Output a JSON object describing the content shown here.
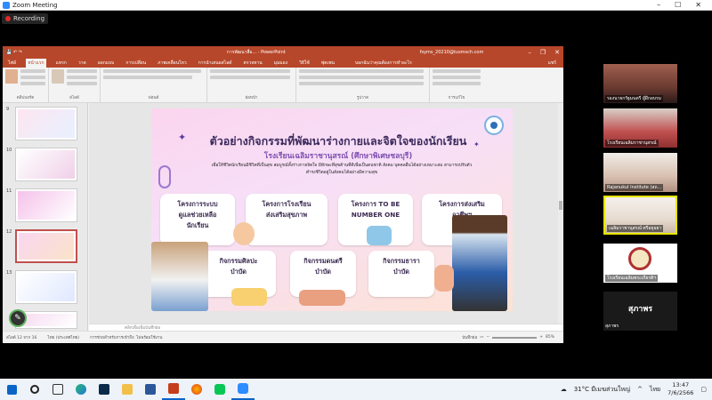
{
  "zoom": {
    "title": "Zoom Meeting",
    "recording": "Recording",
    "window_controls": [
      "–",
      "☐",
      "✕"
    ]
  },
  "ppt": {
    "doc_title": "การพัฒนาสื่อ... - PowerPoint",
    "user": "fsyms_20210@tusmsch.com",
    "tabs": [
      "ไฟล์",
      "หน้าแรก",
      "แทรก",
      "วาด",
      "ออกแบบ",
      "การเปลี่ยน",
      "ภาพเคลื่อนไหว",
      "การนำเสนอสไลด์",
      "ตรวจทาน",
      "มุมมอง",
      "วิธีใช้",
      "ฟุตเพน",
      "Tell me",
      "บอกฉันว่าคุณต้องการทำอะไร"
    ],
    "active_tab_index": 1,
    "share": "แชร์",
    "ribbon_groups": [
      "คลิปบอร์ด",
      "สไลด์",
      "ฟอนต์",
      "ย่อหน้า",
      "รูปวาด",
      "การแก้ไข"
    ],
    "thumb_numbers": [
      "9",
      "10",
      "11",
      "12",
      "13"
    ],
    "selected_slide": "12",
    "notes_placeholder": "คลิกเพื่อเพิ่มบันทึกย่อ",
    "status_left": "สไลด์ 12 จาก 16",
    "status_lang": "ไทย (ประเทศไทย)",
    "status_access": "การช่วยสำหรับการเข้าถึง: ไม่พร้อมใช้งาน",
    "status_notes": "บันทึกย่อ",
    "zoom_level": "85%"
  },
  "slide": {
    "title": "ตัวอย่างกิจกรรมที่พัฒนาร่างกายและจิตใจของนักเรียน",
    "subtitle": "โรงเรียนเฉลิมราชานุสรณ์ (ศึกษาพิเศษชลบุรี)",
    "description": "เพื่อให้ชีวิตนักเรียนมีชีวิตที่เป็นสุข สมบูรณ์ทั้งร่างกายจิตใจ มีทักษะที่สุขด้านที่ดีเพื่อเป็นตนชาติ สังคม บุคคลอื่นได้อย่างเหมาะสม สามารถปรับตัวดำรงชีวิตอยู่ในสังคมได้อย่างมีความสุข",
    "cards": [
      "โครงการระบบ\nดูแลช่วยเหลือ\nนักเรียน",
      "โครงการโรงเรียน\nส่งเสริมสุขภาพ",
      "โครงการ TO BE\nNUMBER ONE",
      "โครงการส่งเสริม\nอาชีพฯ",
      "กิจกรรมศิลปะ\nบำบัด",
      "กิจกรรมดนตรี\nบำบัด",
      "กิจกรรมธารา\nบำบัด"
    ]
  },
  "participants": [
    {
      "name": "รองนายกรัฐมนตรี ผู้ฝึกอบรม"
    },
    {
      "name": "โรงเรียนเฉลิมราชานุสรณ์"
    },
    {
      "name": "Rajanukul Institute (สถ..."
    },
    {
      "name": "เฉลิมราชานุสรณ์ ศรีอยุธยา"
    },
    {
      "name": "โรงเรียนเฉลิมพระเกียรติฯ"
    }
  ],
  "namecard": {
    "big": "สุภาพร",
    "name": "สุภาพร"
  },
  "taskbar": {
    "weather": "31°C มีเมฆส่วนใหญ่",
    "lang": "ไทย",
    "time": "13:47",
    "date": "7/6/2566"
  },
  "colors": {
    "ppt_accent": "#b7472a",
    "zoom_blue": "#2d8cff",
    "slide_title": "#3b2a5c"
  }
}
